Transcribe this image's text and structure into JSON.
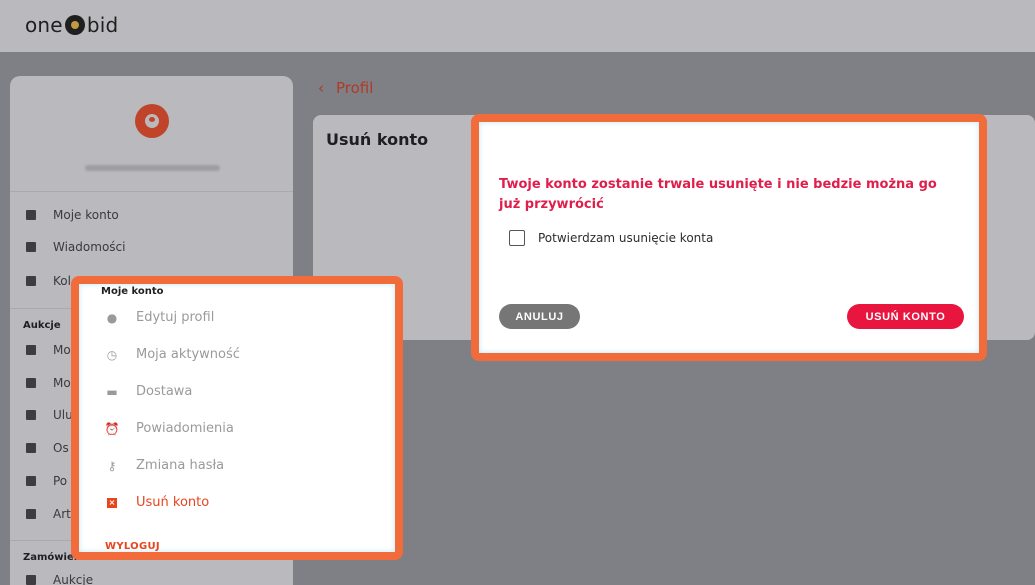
{
  "brand": {
    "left": "one",
    "right": "bid"
  },
  "sidebar": {
    "items": [
      {
        "label": "Moje konto",
        "icon": "dashboard-icon"
      },
      {
        "label": "Wiadomości",
        "icon": "message-icon"
      },
      {
        "label": "Kol",
        "icon": "collection-icon"
      },
      {
        "label": "Mo",
        "icon": "gavel-icon"
      },
      {
        "label": "Mo",
        "icon": "basket-icon"
      },
      {
        "label": "Ulu",
        "icon": "star-icon"
      },
      {
        "label": "Os",
        "icon": "document-icon"
      },
      {
        "label": "Po",
        "icon": "search-icon"
      },
      {
        "label": "Art",
        "icon": "heart-icon"
      },
      {
        "label": "Aukcje",
        "icon": "gavel-icon"
      }
    ],
    "sections": {
      "auctions": "Aukcje",
      "orders": "Zamówienia"
    }
  },
  "breadcrumb": {
    "back_label": "Profil"
  },
  "page": {
    "title": "Usuń konto"
  },
  "dialog": {
    "message": "Twoje konto zostanie trwale usunięte i nie bedzie można go już przywrócić",
    "confirm_label": "Potwierdzam usunięcie konta",
    "cancel_label": "ANULUJ",
    "delete_label": "USUŃ KONTO"
  },
  "menu": {
    "heading": "Moje konto",
    "items": [
      {
        "label": "Edytuj profil",
        "icon": "user-icon"
      },
      {
        "label": "Moja aktywność",
        "icon": "clock-icon"
      },
      {
        "label": "Dostawa",
        "icon": "truck-icon"
      },
      {
        "label": "Powiadomienia",
        "icon": "alarm-icon"
      },
      {
        "label": "Zmiana hasła",
        "icon": "key-icon"
      },
      {
        "label": "Usuń konto",
        "icon": "delete-box-icon"
      }
    ],
    "logout_label": "WYLOGUJ"
  },
  "colors": {
    "accent": "#e8451e",
    "danger": "#e8153f",
    "highlight_frame": "#f26b3a"
  }
}
